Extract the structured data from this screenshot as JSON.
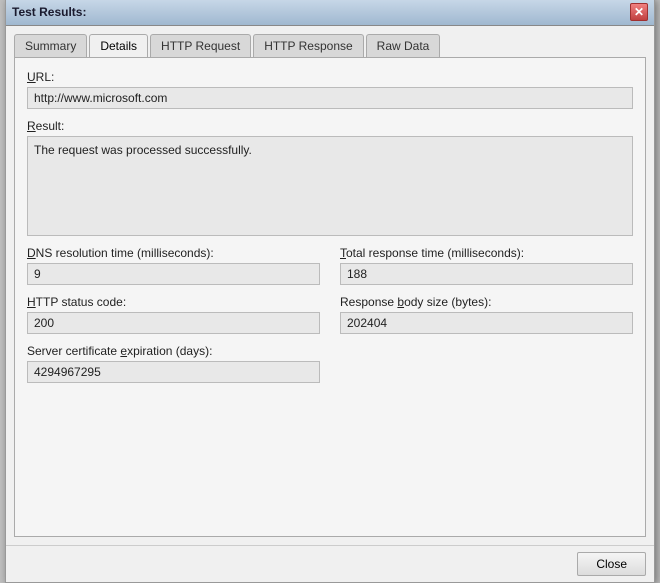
{
  "window": {
    "title": "Test Results:",
    "close_icon": "✕"
  },
  "tabs": [
    {
      "id": "summary",
      "label": "Summary",
      "underline_char": "S",
      "active": false
    },
    {
      "id": "details",
      "label": "Details",
      "underline_char": "D",
      "active": true
    },
    {
      "id": "http-request",
      "label": "HTTP Request",
      "underline_char": "H",
      "active": false
    },
    {
      "id": "http-response",
      "label": "HTTP Response",
      "underline_char": "R",
      "active": false
    },
    {
      "id": "raw-data",
      "label": "Raw Data",
      "underline_char": "a",
      "active": false
    }
  ],
  "details": {
    "url_label": "URL:",
    "url_value": "http://www.microsoft.com",
    "result_label": "Result:",
    "result_value": "The request was processed successfully.",
    "dns_label": "DNS resolution time (milliseconds):",
    "dns_underline": "D",
    "dns_value": "9",
    "total_response_label": "Total response time (milliseconds):",
    "total_response_underline": "T",
    "total_response_value": "188",
    "http_status_label": "HTTP status code:",
    "http_status_underline": "H",
    "http_status_value": "200",
    "response_body_label": "Response body size (bytes):",
    "response_body_underline": "b",
    "response_body_value": "202404",
    "cert_label": "Server certificate expiration (days):",
    "cert_underline": "e",
    "cert_value": "4294967295"
  },
  "buttons": {
    "close_label": "Close"
  }
}
